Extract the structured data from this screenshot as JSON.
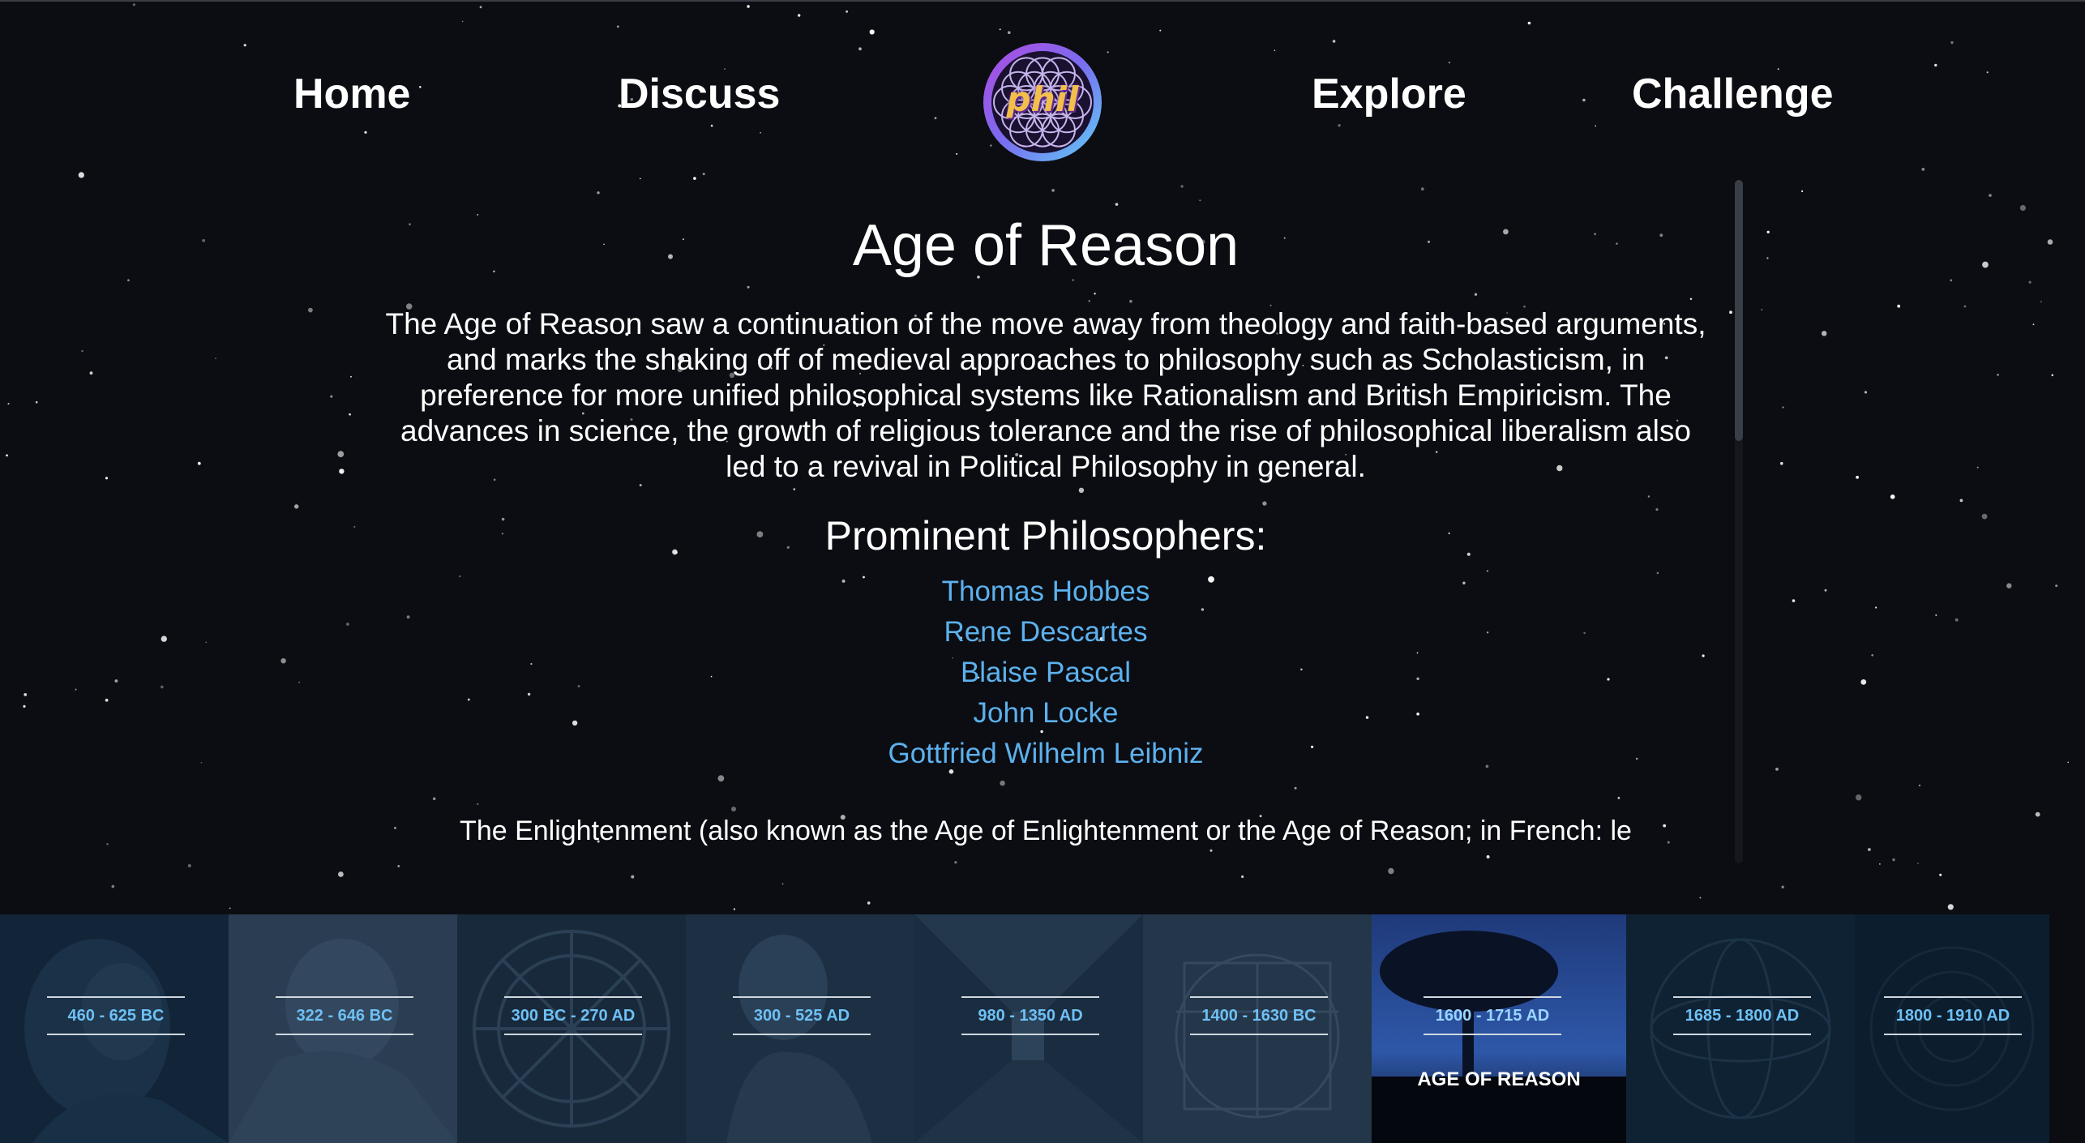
{
  "nav": {
    "home": "Home",
    "discuss": "Discuss",
    "explore": "Explore",
    "challenge": "Challenge",
    "logo_text": "phil"
  },
  "era": {
    "title": "Age of Reason",
    "intro": "The Age of Reason saw a continuation of the move away from theology and faith-based arguments, and marks the shaking off of medieval approaches to philosophy such as Scholasticism, in preference for more unified philosophical systems like Rationalism and British Empiricism. The advances in science, the growth of religious tolerance and the rise of philosophical liberalism also led to a revival in Political Philosophy in general.",
    "philosophers_heading": "Prominent Philosophers:",
    "philosophers": [
      "Thomas Hobbes",
      "Rene Descartes",
      "Blaise Pascal",
      "John Locke",
      "Gottfried Wilhelm Leibniz"
    ],
    "more_text": "The Enlightenment (also known as the Age of Enlightenment or the Age of Reason; in French: le"
  },
  "timeline": [
    {
      "date": "460 - 625 BC",
      "active": false
    },
    {
      "date": "322 - 646 BC",
      "active": false
    },
    {
      "date": "300 BC - 270 AD",
      "active": false
    },
    {
      "date": "300 - 525 AD",
      "active": false
    },
    {
      "date": "980 - 1350 AD",
      "active": false
    },
    {
      "date": "1400 - 1630 BC",
      "active": false
    },
    {
      "date": "1600 - 1715 AD",
      "active": true,
      "name": "AGE OF REASON"
    },
    {
      "date": "1685 - 1800 AD",
      "active": false
    },
    {
      "date": "1800 - 1910 AD",
      "active": false
    }
  ],
  "colors": {
    "background": "#0b0d12",
    "link": "#5cb1ee",
    "timeline_date": "#6ec0f5",
    "logo_text": "#f2c04a"
  }
}
